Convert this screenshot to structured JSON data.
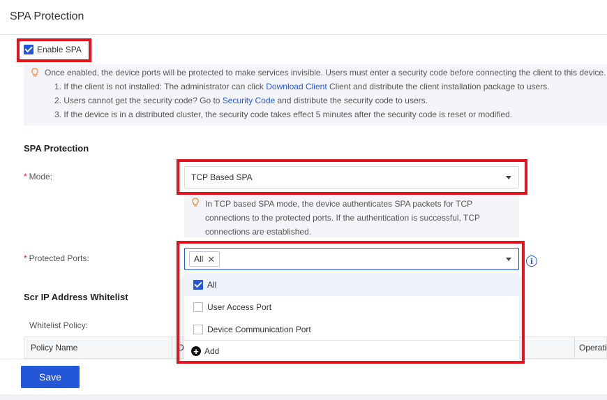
{
  "page": {
    "title": "SPA Protection"
  },
  "enable_spa": {
    "label": "Enable SPA",
    "checked": true
  },
  "notice": {
    "line0": "Once enabled, the device ports will be protected to make services invisible. Users must enter a security code before connecting the client to this device.",
    "line1_pre": "1. If the client is not installed: The administrator can click ",
    "line1_link": "Download Client",
    "line1_post": " Client and distribute the client installation package to users.",
    "line2_pre": "2. Users cannot get the security code? Go to  ",
    "line2_link": "Security Code",
    "line2_post": " and distribute the security code to users.",
    "line3": "3. If the device is in a distributed cluster, the security code takes effect 5 minutes after the security code is reset or modified."
  },
  "spa_section": {
    "title": "SPA Protection"
  },
  "mode": {
    "required_mark": "*",
    "label": "Mode:",
    "value": "TCP Based SPA",
    "hint": "In TCP based SPA mode, the device authenticates SPA packets for TCP connections to the protected ports. If the authentication is successful, TCP connections are established."
  },
  "protected_ports": {
    "required_mark": "*",
    "label": "Protected Ports:",
    "tag": "All",
    "tag_remove": "✕",
    "info_glyph": "i",
    "options": [
      {
        "label": "All",
        "checked": true
      },
      {
        "label": "User Access Port",
        "checked": false
      },
      {
        "label": "Device Communication Port",
        "checked": false
      }
    ],
    "add_label": "Add",
    "add_glyph": "+"
  },
  "whitelist": {
    "title": "Scr IP Address Whitelist",
    "policy_label": "Whitelist Policy:",
    "columns": [
      "Policy Name",
      "De",
      "Operation"
    ]
  },
  "footer": {
    "save_label": "Save"
  },
  "colors": {
    "accent": "#2456d8",
    "highlight_red": "#e3141e",
    "hint_bg": "#f3f5f8"
  }
}
